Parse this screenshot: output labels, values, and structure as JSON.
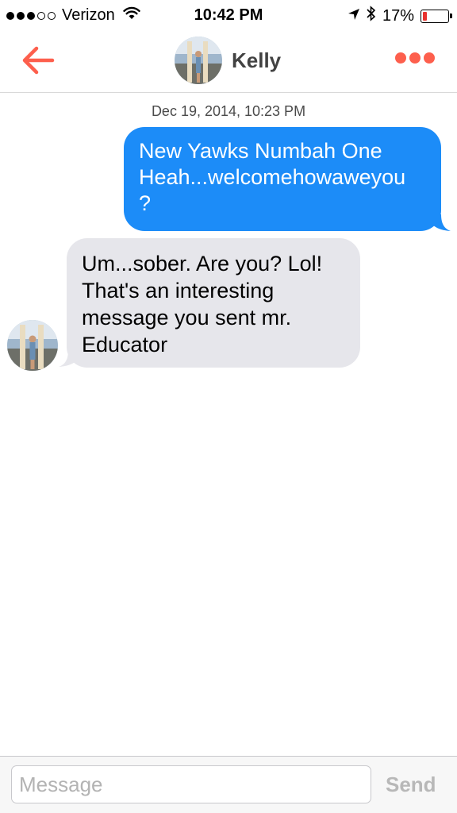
{
  "status_bar": {
    "carrier": "Verizon",
    "time": "10:42 PM",
    "battery_percent": "17%",
    "battery_level": 0.17,
    "signal_bars_filled": 3,
    "signal_bars_total": 5,
    "icons": [
      "wifi-icon",
      "location-arrow-icon",
      "bluetooth-icon",
      "battery-icon"
    ]
  },
  "header": {
    "contact_name": "Kelly",
    "accent_color": "#fd5f4d",
    "icons": [
      "back-arrow-icon",
      "more-dots-icon"
    ]
  },
  "conversation": {
    "timestamp": "Dec 19, 2014, 10:23 PM",
    "messages": [
      {
        "direction": "outgoing",
        "lines": [
          "New Yawks Numbah One",
          "Heah...welcomehowaweyou",
          "?"
        ],
        "bubble_color": "#1c8cf8"
      },
      {
        "direction": "incoming",
        "lines": [
          "Um...sober. Are you? Lol!",
          "That's an interesting",
          "message you sent mr.",
          "Educator"
        ],
        "bubble_color": "#e6e6eb"
      }
    ]
  },
  "compose": {
    "placeholder": "Message",
    "value": "",
    "send_label": "Send"
  }
}
